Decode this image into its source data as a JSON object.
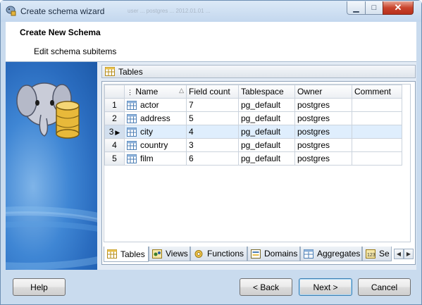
{
  "window": {
    "title": "Create schema wizard",
    "ghost_text": "user    ...    postgres    ...    2012.01.01  ...",
    "minimize_glyph": "▁",
    "maximize_glyph": "□",
    "close_glyph": "✕"
  },
  "header": {
    "title": "Create New Schema",
    "subtitle": "Edit schema subitems"
  },
  "section": {
    "label": "Tables"
  },
  "grid": {
    "columns": [
      "Name",
      "Field count",
      "Tablespace",
      "Owner",
      "Comment"
    ],
    "rows": [
      {
        "num": "1",
        "name": "actor",
        "field_count": "7",
        "tablespace": "pg_default",
        "owner": "postgres",
        "comment": ""
      },
      {
        "num": "2",
        "name": "address",
        "field_count": "5",
        "tablespace": "pg_default",
        "owner": "postgres",
        "comment": ""
      },
      {
        "num": "3",
        "name": "city",
        "field_count": "4",
        "tablespace": "pg_default",
        "owner": "postgres",
        "comment": ""
      },
      {
        "num": "4",
        "name": "country",
        "field_count": "3",
        "tablespace": "pg_default",
        "owner": "postgres",
        "comment": ""
      },
      {
        "num": "5",
        "name": "film",
        "field_count": "6",
        "tablespace": "pg_default",
        "owner": "postgres",
        "comment": ""
      }
    ],
    "selected_row": 3
  },
  "tabs": [
    "Tables",
    "Views",
    "Functions",
    "Domains",
    "Aggregates",
    "Se"
  ],
  "buttons": {
    "help": "Help",
    "back": "< Back",
    "next": "Next >",
    "cancel": "Cancel"
  },
  "colors": {
    "accent": "#3c7fb1",
    "selected_row": "#dfeefd",
    "side_panel": "#2a6cbf"
  }
}
